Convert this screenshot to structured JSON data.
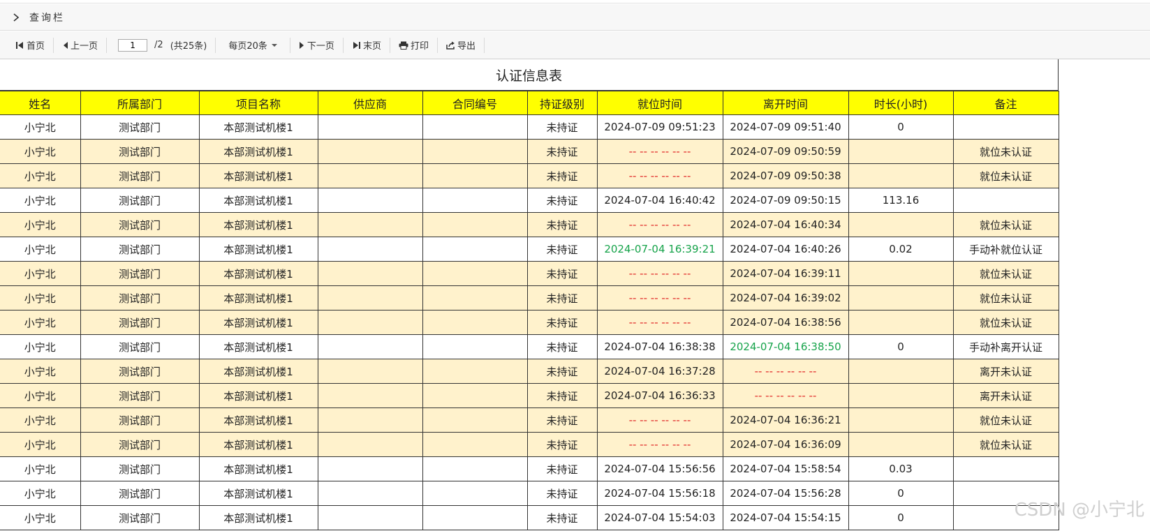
{
  "query_bar": {
    "title": "查询栏"
  },
  "toolbar": {
    "first": "首页",
    "prev": "上一页",
    "page_value": "1",
    "page_total": "/2",
    "total_records": "(共25条)",
    "per_page": "每页20条",
    "next": "下一页",
    "last": "末页",
    "print": "打印",
    "export": "导出"
  },
  "report": {
    "title": "认证信息表",
    "columns": [
      "姓名",
      "所属部门",
      "项目名称",
      "供应商",
      "合同编号",
      "持证级别",
      "就位时间",
      "离开时间",
      "时长(小时)",
      "备注"
    ],
    "rows": [
      {
        "name": "小宁北",
        "dept": "测试部门",
        "project": "本部测试机楼1",
        "supplier": "",
        "contract": "",
        "level": "未持证",
        "arrive": "2024-07-09 09:51:23",
        "leave": "2024-07-09 09:51:40",
        "hours": "0",
        "note": "",
        "alt": false,
        "arrive_style": "",
        "leave_style": ""
      },
      {
        "name": "小宁北",
        "dept": "测试部门",
        "project": "本部测试机楼1",
        "supplier": "",
        "contract": "",
        "level": "未持证",
        "arrive": "-- -- --  -- -- --",
        "leave": "2024-07-09 09:50:59",
        "hours": "",
        "note": "就位未认证",
        "alt": true,
        "arrive_style": "red",
        "leave_style": ""
      },
      {
        "name": "小宁北",
        "dept": "测试部门",
        "project": "本部测试机楼1",
        "supplier": "",
        "contract": "",
        "level": "未持证",
        "arrive": "-- -- --  -- -- --",
        "leave": "2024-07-09 09:50:38",
        "hours": "",
        "note": "就位未认证",
        "alt": true,
        "arrive_style": "red",
        "leave_style": ""
      },
      {
        "name": "小宁北",
        "dept": "测试部门",
        "project": "本部测试机楼1",
        "supplier": "",
        "contract": "",
        "level": "未持证",
        "arrive": "2024-07-04 16:40:42",
        "leave": "2024-07-09 09:50:15",
        "hours": "113.16",
        "note": "",
        "alt": false,
        "arrive_style": "",
        "leave_style": ""
      },
      {
        "name": "小宁北",
        "dept": "测试部门",
        "project": "本部测试机楼1",
        "supplier": "",
        "contract": "",
        "level": "未持证",
        "arrive": "-- -- --  -- -- --",
        "leave": "2024-07-04 16:40:34",
        "hours": "",
        "note": "就位未认证",
        "alt": true,
        "arrive_style": "red",
        "leave_style": ""
      },
      {
        "name": "小宁北",
        "dept": "测试部门",
        "project": "本部测试机楼1",
        "supplier": "",
        "contract": "",
        "level": "未持证",
        "arrive": "2024-07-04 16:39:21",
        "leave": "2024-07-04 16:40:26",
        "hours": "0.02",
        "note": "手动补就位认证",
        "alt": false,
        "arrive_style": "green",
        "leave_style": ""
      },
      {
        "name": "小宁北",
        "dept": "测试部门",
        "project": "本部测试机楼1",
        "supplier": "",
        "contract": "",
        "level": "未持证",
        "arrive": "-- -- --  -- -- --",
        "leave": "2024-07-04 16:39:11",
        "hours": "",
        "note": "就位未认证",
        "alt": true,
        "arrive_style": "red",
        "leave_style": ""
      },
      {
        "name": "小宁北",
        "dept": "测试部门",
        "project": "本部测试机楼1",
        "supplier": "",
        "contract": "",
        "level": "未持证",
        "arrive": "-- -- --  -- -- --",
        "leave": "2024-07-04 16:39:02",
        "hours": "",
        "note": "就位未认证",
        "alt": true,
        "arrive_style": "red",
        "leave_style": ""
      },
      {
        "name": "小宁北",
        "dept": "测试部门",
        "project": "本部测试机楼1",
        "supplier": "",
        "contract": "",
        "level": "未持证",
        "arrive": "-- -- --  -- -- --",
        "leave": "2024-07-04 16:38:56",
        "hours": "",
        "note": "就位未认证",
        "alt": true,
        "arrive_style": "red",
        "leave_style": ""
      },
      {
        "name": "小宁北",
        "dept": "测试部门",
        "project": "本部测试机楼1",
        "supplier": "",
        "contract": "",
        "level": "未持证",
        "arrive": "2024-07-04 16:38:38",
        "leave": "2024-07-04 16:38:50",
        "hours": "0",
        "note": "手动补离开认证",
        "alt": false,
        "arrive_style": "",
        "leave_style": "green"
      },
      {
        "name": "小宁北",
        "dept": "测试部门",
        "project": "本部测试机楼1",
        "supplier": "",
        "contract": "",
        "level": "未持证",
        "arrive": "2024-07-04 16:37:28",
        "leave": "-- -- --  -- -- --",
        "hours": "",
        "note": "离开未认证",
        "alt": true,
        "arrive_style": "",
        "leave_style": "red"
      },
      {
        "name": "小宁北",
        "dept": "测试部门",
        "project": "本部测试机楼1",
        "supplier": "",
        "contract": "",
        "level": "未持证",
        "arrive": "2024-07-04 16:36:33",
        "leave": "-- -- --  -- -- --",
        "hours": "",
        "note": "离开未认证",
        "alt": true,
        "arrive_style": "",
        "leave_style": "red"
      },
      {
        "name": "小宁北",
        "dept": "测试部门",
        "project": "本部测试机楼1",
        "supplier": "",
        "contract": "",
        "level": "未持证",
        "arrive": "-- -- --  -- -- --",
        "leave": "2024-07-04 16:36:21",
        "hours": "",
        "note": "就位未认证",
        "alt": true,
        "arrive_style": "red",
        "leave_style": ""
      },
      {
        "name": "小宁北",
        "dept": "测试部门",
        "project": "本部测试机楼1",
        "supplier": "",
        "contract": "",
        "level": "未持证",
        "arrive": "-- -- --  -- -- --",
        "leave": "2024-07-04 16:36:09",
        "hours": "",
        "note": "就位未认证",
        "alt": true,
        "arrive_style": "red",
        "leave_style": ""
      },
      {
        "name": "小宁北",
        "dept": "测试部门",
        "project": "本部测试机楼1",
        "supplier": "",
        "contract": "",
        "level": "未持证",
        "arrive": "2024-07-04 15:56:56",
        "leave": "2024-07-04 15:58:54",
        "hours": "0.03",
        "note": "",
        "alt": false,
        "arrive_style": "",
        "leave_style": ""
      },
      {
        "name": "小宁北",
        "dept": "测试部门",
        "project": "本部测试机楼1",
        "supplier": "",
        "contract": "",
        "level": "未持证",
        "arrive": "2024-07-04 15:56:18",
        "leave": "2024-07-04 15:56:28",
        "hours": "0",
        "note": "",
        "alt": false,
        "arrive_style": "",
        "leave_style": ""
      },
      {
        "name": "小宁北",
        "dept": "测试部门",
        "project": "本部测试机楼1",
        "supplier": "",
        "contract": "",
        "level": "未持证",
        "arrive": "2024-07-04 15:54:03",
        "leave": "2024-07-04 15:54:15",
        "hours": "0",
        "note": "",
        "alt": false,
        "arrive_style": "",
        "leave_style": ""
      }
    ]
  },
  "colors": {
    "header_bg": "#ffff00",
    "alt_row_bg": "#fff2cc",
    "missing_time": "#e02424",
    "manual_time": "#16a34a"
  },
  "watermark": "CSDN @小宁北"
}
